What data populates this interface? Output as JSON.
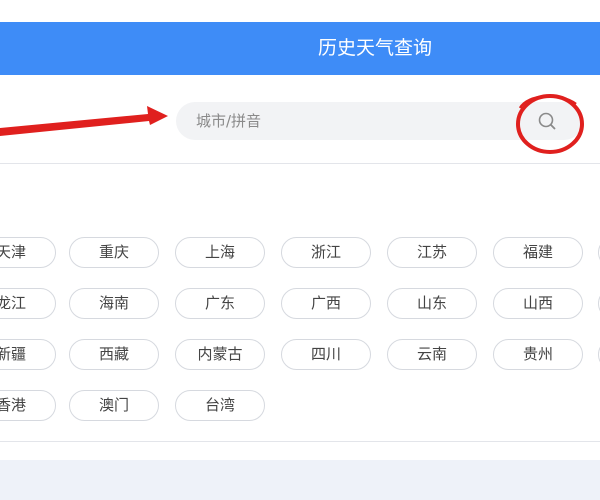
{
  "header": {
    "title": "历史天气查询"
  },
  "search": {
    "placeholder": "城市/拼音",
    "value": ""
  },
  "provinces": [
    [
      "天津",
      "重庆",
      "上海",
      "浙江",
      "江苏",
      "福建"
    ],
    [
      "龙江",
      "海南",
      "广东",
      "广西",
      "山东",
      "山西"
    ],
    [
      "新疆",
      "西藏",
      "内蒙古",
      "四川",
      "云南",
      "贵州"
    ],
    [
      "香港",
      "澳门",
      "台湾"
    ]
  ],
  "colors": {
    "header_bg": "#3e8cf7",
    "annotation_red": "#e0201e"
  },
  "icons": {
    "search": "search-icon"
  }
}
